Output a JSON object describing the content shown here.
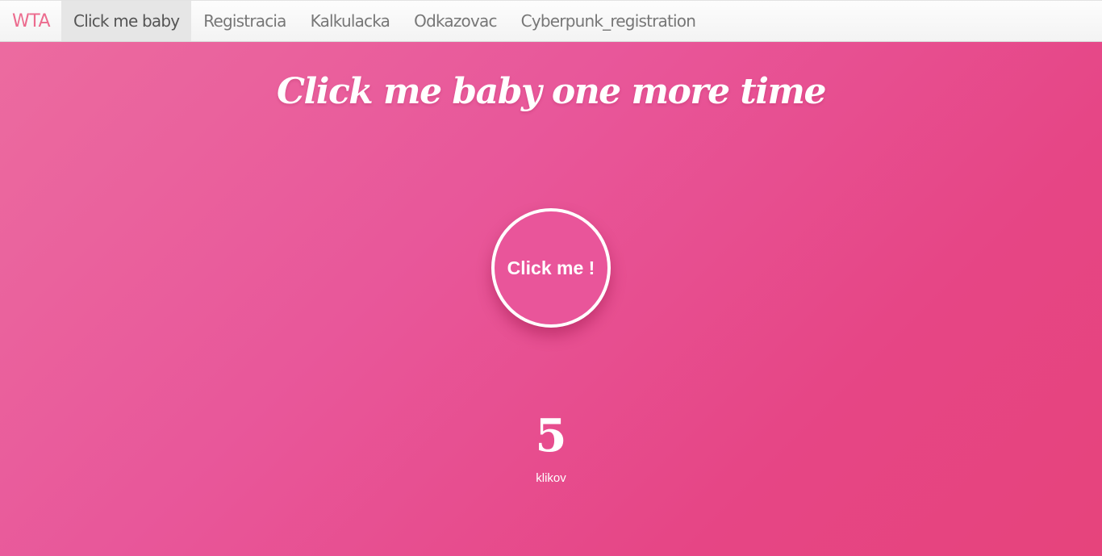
{
  "navbar": {
    "brand": "WTA",
    "items": [
      {
        "label": "Click me baby",
        "active": true
      },
      {
        "label": "Registracia",
        "active": false
      },
      {
        "label": "Kalkulacka",
        "active": false
      },
      {
        "label": "Odkazovac",
        "active": false
      },
      {
        "label": "Cyberpunk_registration",
        "active": false
      }
    ]
  },
  "main": {
    "title": "Click me baby one more time",
    "button_label": "Click me !",
    "click_count": "5",
    "count_label": "klikov"
  },
  "colors": {
    "brand": "#ec6b8e",
    "background_start": "#ec6ca0",
    "background_end": "#e6447c",
    "button_fill": "#e9559a"
  }
}
